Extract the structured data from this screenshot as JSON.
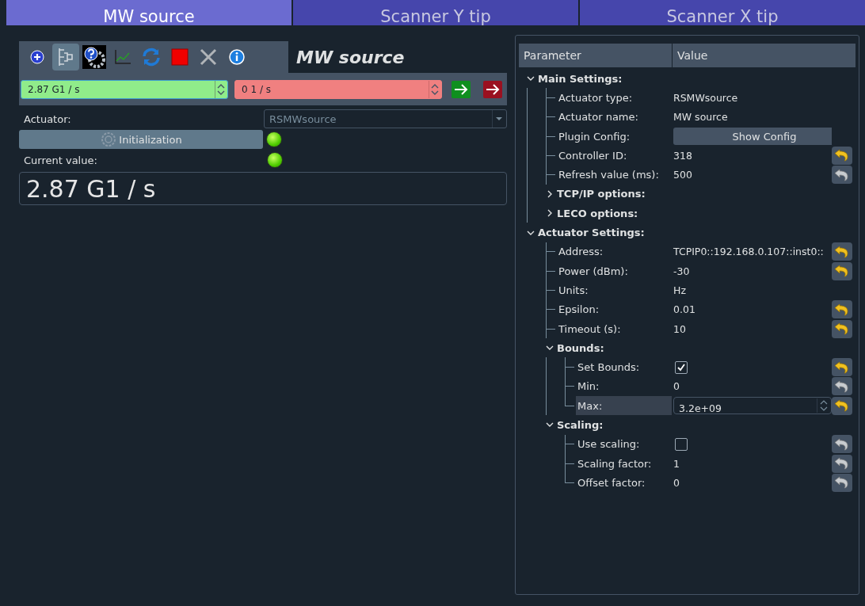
{
  "tabs": [
    {
      "label": "MW source",
      "selected": true
    },
    {
      "label": "Scanner Y tip",
      "selected": false
    },
    {
      "label": "Scanner X tip",
      "selected": false
    }
  ],
  "actuator_panel": {
    "toolbar": {
      "buttons": [
        {
          "kind": "add",
          "checked": false
        },
        {
          "kind": "settings-tree",
          "checked": true
        },
        {
          "kind": "help",
          "checked": false
        },
        {
          "kind": "plot",
          "checked": false
        },
        {
          "kind": "refresh",
          "checked": false
        },
        {
          "kind": "stop",
          "checked": false
        },
        {
          "kind": "quit",
          "checked": false
        },
        {
          "kind": "info",
          "checked": false
        }
      ],
      "title": "MW source"
    },
    "absolute_field": {
      "value": "2.87 G1 / s"
    },
    "relative_field": {
      "value": "0 1 / s"
    },
    "actuator_label": "Actuator:",
    "actuator_combo": {
      "value": "RSMWsource",
      "disabled": true
    },
    "init_button": {
      "label": "Initialization"
    },
    "init_led": {
      "on": true
    },
    "current_label": "Current value:",
    "current_led": {
      "on": true
    },
    "current_value": "2.87 G1 / s"
  },
  "settings_tree": {
    "columns": [
      "Parameter",
      "Value"
    ],
    "items": [
      {
        "label": "Main Settings:",
        "expanded": true,
        "children": [
          {
            "label": "Actuator type:",
            "kind": "text",
            "value": "RSMWsource",
            "selected": false
          },
          {
            "label": "Actuator name:",
            "kind": "text",
            "value": "MW source",
            "selected": false
          },
          {
            "label": "Plugin Config:",
            "kind": "button",
            "value": "Show Config",
            "selected": false
          },
          {
            "label": "Controller ID:",
            "kind": "text",
            "value": "318",
            "modified": true,
            "selected": false
          },
          {
            "label": "Refresh value (ms):",
            "kind": "text",
            "value": "500",
            "modified": false,
            "selected": false
          },
          {
            "label": "TCP/IP options:",
            "expanded": false
          },
          {
            "label": "LECO options:",
            "expanded": false
          }
        ]
      },
      {
        "label": "Actuator Settings:",
        "expanded": true,
        "children": [
          {
            "label": "Address:",
            "kind": "text",
            "value": "TCPIP0::192.168.0.107::inst0::",
            "modified": true,
            "selected": false
          },
          {
            "label": "Power (dBm):",
            "kind": "text",
            "value": "-30",
            "modified": true,
            "selected": false
          },
          {
            "label": "Units:",
            "kind": "text",
            "value": "Hz",
            "selected": false
          },
          {
            "label": "Epsilon:",
            "kind": "text",
            "value": "0.01",
            "modified": true,
            "selected": false
          },
          {
            "label": "Timeout (s):",
            "kind": "text",
            "value": "10",
            "modified": true,
            "selected": false
          },
          {
            "label": "Bounds:",
            "expanded": true,
            "children": [
              {
                "label": "Set Bounds:",
                "kind": "checkbox",
                "checked": true,
                "modified": true,
                "selected": false
              },
              {
                "label": "Min:",
                "kind": "text",
                "value": "0",
                "modified": false,
                "selected": false
              },
              {
                "label": "Max:",
                "kind": "spin",
                "value": "3.2e+09",
                "modified": true,
                "selected": true
              }
            ]
          },
          {
            "label": "Scaling:",
            "expanded": true,
            "children": [
              {
                "label": "Use scaling:",
                "kind": "checkbox",
                "checked": false,
                "modified": false,
                "selected": false
              },
              {
                "label": "Scaling factor:",
                "kind": "text",
                "value": "1",
                "modified": false,
                "selected": false
              },
              {
                "label": "Offset factor:",
                "kind": "text",
                "value": "0",
                "modified": false,
                "selected": false
              }
            ]
          }
        ]
      }
    ]
  }
}
